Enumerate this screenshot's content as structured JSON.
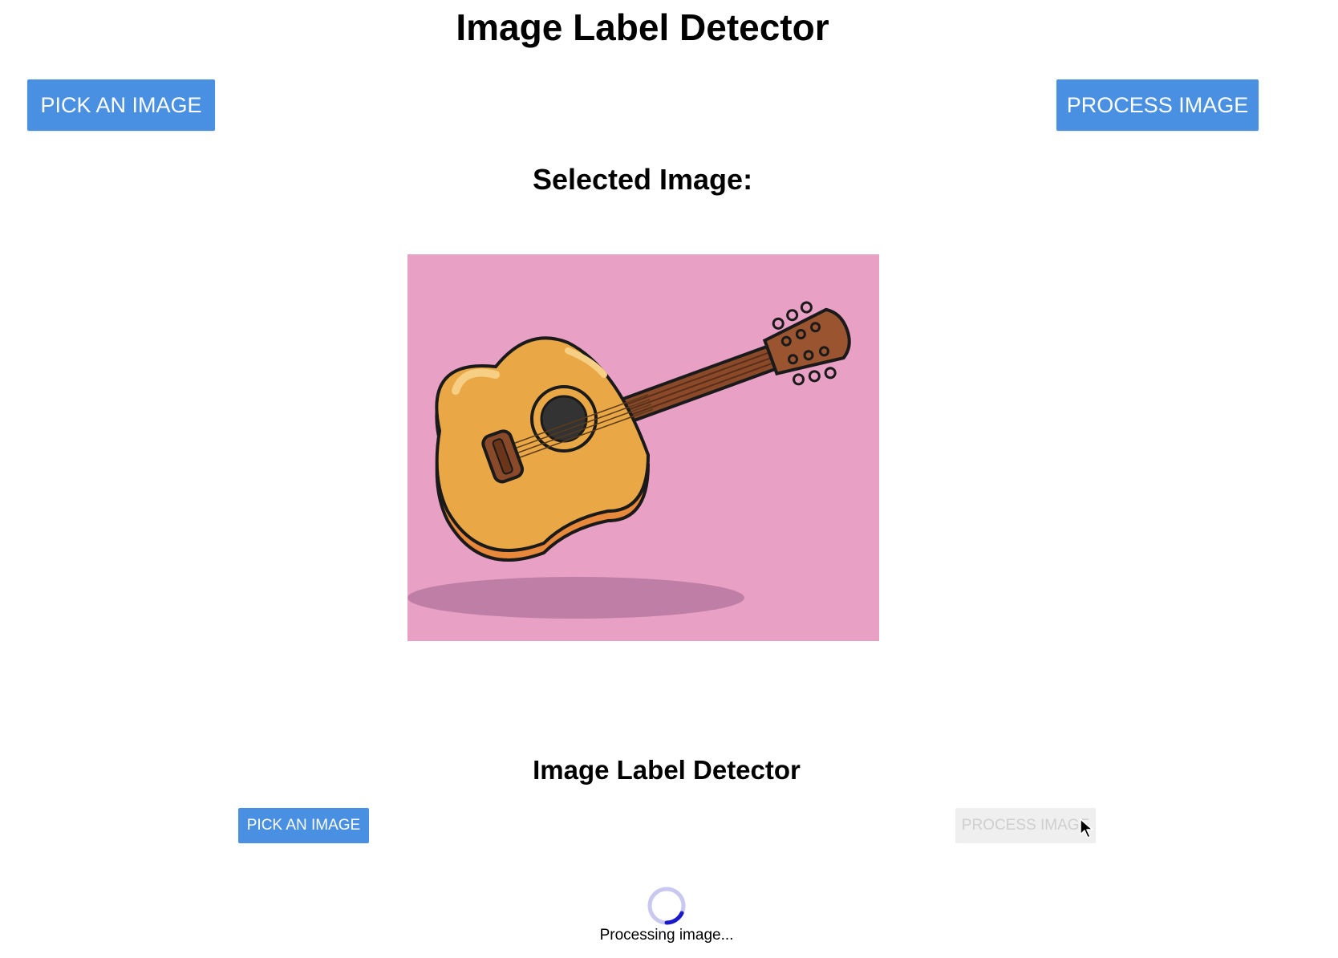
{
  "header": {
    "title": "Image Label Detector"
  },
  "toolbar": {
    "pick_label": "PICK AN IMAGE",
    "process_label": "PROCESS IMAGE"
  },
  "main": {
    "selected_label": "Selected Image:",
    "image_icon": "guitar-illustration",
    "image_background": "#e8a0c4"
  },
  "overlay": {
    "title": "Image Label Detector",
    "pick_label": "PICK AN IMAGE",
    "process_label": "PROCESS IMAGE",
    "process_disabled": true,
    "status_text": "Processing image...",
    "spinner_icon": "loading-spinner-icon"
  },
  "colors": {
    "accent": "#4a90e2",
    "disabled_bg": "#efefef",
    "disabled_text": "#cfcfcf",
    "spinner_track": "#c8c8f0",
    "spinner_arc": "#1a1acc"
  }
}
